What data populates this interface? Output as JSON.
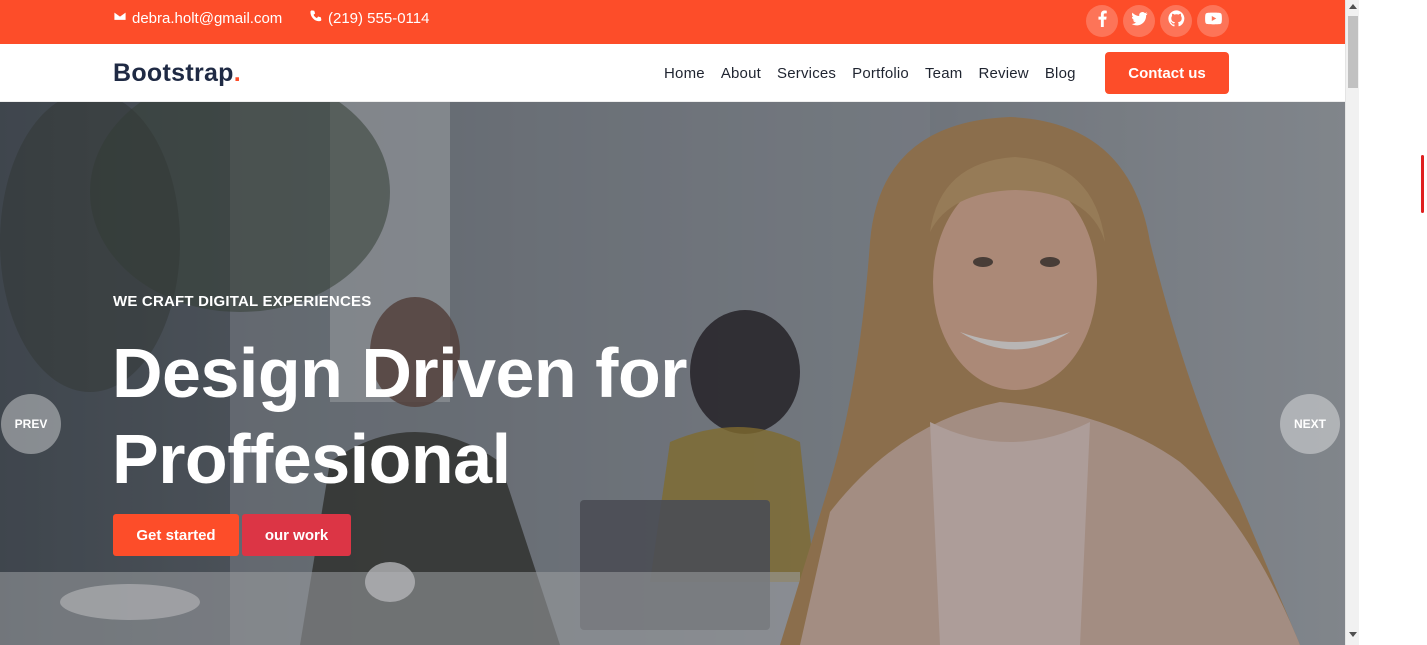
{
  "topbar": {
    "email": "debra.holt@gmail.com",
    "phone": "(219) 555-0114",
    "email_icon": "envelope-icon",
    "phone_icon": "phone-icon",
    "social": [
      "facebook-icon",
      "twitter-icon",
      "github-icon",
      "youtube-icon"
    ],
    "accent_color": "#fd4d29"
  },
  "navbar": {
    "brand": "Bootstrap",
    "brand_dot": ".",
    "links": [
      "Home",
      "About",
      "Services",
      "Portfolio",
      "Team",
      "Review",
      "Blog"
    ],
    "cta_label": "Contact us"
  },
  "hero": {
    "eyebrow": "WE CRAFT DIGITAL EXPERIENCES",
    "headline_line1": "Design Driven for",
    "headline_line2": "Proffesional",
    "primary_button": "Get started",
    "secondary_button": "our work",
    "prev_label": "PREV",
    "next_label": "NEXT",
    "secondary_color": "#dc3545"
  }
}
